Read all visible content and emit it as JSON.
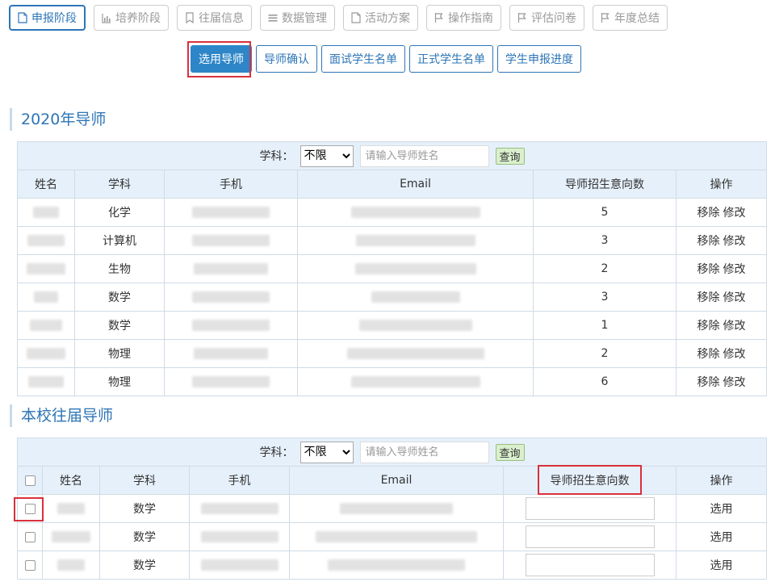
{
  "stage_tabs": [
    {
      "label": "申报阶段",
      "icon": "document-icon",
      "active": true
    },
    {
      "label": "培养阶段",
      "icon": "bar-chart-icon",
      "active": false
    },
    {
      "label": "往届信息",
      "icon": "bookmark-icon",
      "active": false
    },
    {
      "label": "数据管理",
      "icon": "list-icon",
      "active": false
    },
    {
      "label": "活动方案",
      "icon": "document-icon",
      "active": false
    },
    {
      "label": "操作指南",
      "icon": "flag-icon",
      "active": false
    },
    {
      "label": "评估问卷",
      "icon": "flag-icon",
      "active": false
    },
    {
      "label": "年度总结",
      "icon": "flag-icon",
      "active": false
    }
  ],
  "sub_tabs": [
    {
      "label": "选用导师",
      "active": true
    },
    {
      "label": "导师确认",
      "active": false
    },
    {
      "label": "面试学生名单",
      "active": false
    },
    {
      "label": "正式学生名单",
      "active": false
    },
    {
      "label": "学生申报进度",
      "active": false
    }
  ],
  "section1": {
    "title": "2020年导师",
    "filter": {
      "subject_label": "学科：",
      "subject_value": "不限",
      "name_placeholder": "请输入导师姓名",
      "query_label": "查询"
    },
    "columns": [
      "姓名",
      "学科",
      "手机",
      "Email",
      "导师招生意向数",
      "操作"
    ],
    "rows": [
      {
        "subject": "化学",
        "count": "5"
      },
      {
        "subject": "计算机",
        "count": "3"
      },
      {
        "subject": "生物",
        "count": "2"
      },
      {
        "subject": "数学",
        "count": "3"
      },
      {
        "subject": "数学",
        "count": "1"
      },
      {
        "subject": "物理",
        "count": "2"
      },
      {
        "subject": "物理",
        "count": "6"
      }
    ],
    "op_remove": "移除",
    "op_edit": "修改"
  },
  "section2": {
    "title": "本校往届导师",
    "filter": {
      "subject_label": "学科：",
      "subject_value": "不限",
      "name_placeholder": "请输入导师姓名",
      "query_label": "查询"
    },
    "columns": [
      "姓名",
      "学科",
      "手机",
      "Email",
      "导师招生意向数",
      "操作"
    ],
    "rows": [
      {
        "subject": "数学"
      },
      {
        "subject": "数学"
      },
      {
        "subject": "数学"
      }
    ],
    "op_select": "选用"
  },
  "colors": {
    "accent": "#2e75b6",
    "header_bg": "#e6f0fa",
    "highlight": "#d9303b"
  }
}
